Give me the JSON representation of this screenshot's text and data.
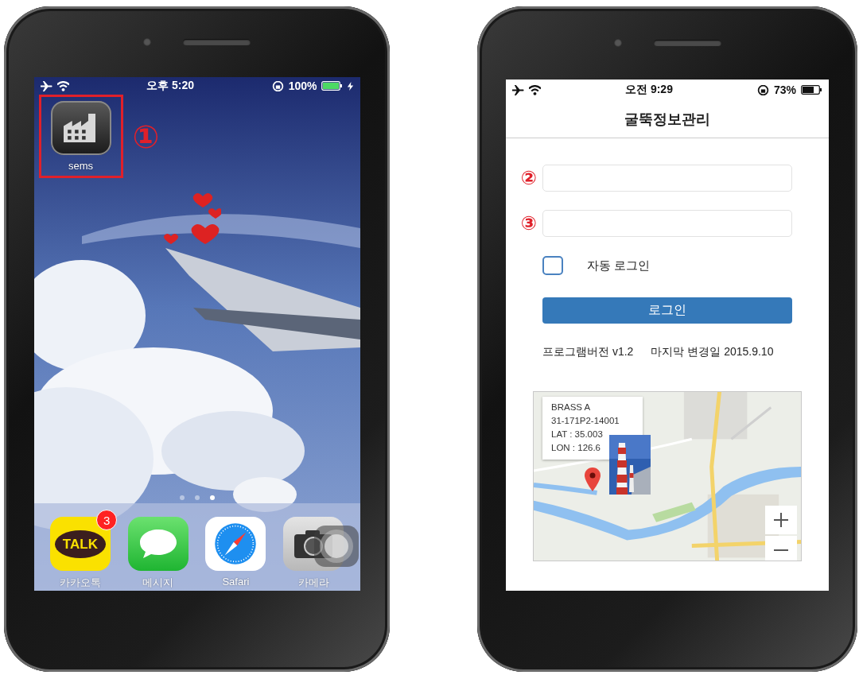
{
  "phones": [
    {
      "kind": "home_screen",
      "status_bar": {
        "time": "오후 5:20",
        "battery": "100%",
        "charging": true
      },
      "apps": [
        {
          "label": "sems",
          "kind": "factory",
          "highlighted": true,
          "callout": "①"
        }
      ],
      "page_dots": [
        {
          "selected": false
        },
        {
          "selected": false
        },
        {
          "selected": true
        }
      ],
      "dock": [
        {
          "label": "카카오톡",
          "kind": "talk",
          "icon_text": "TALK",
          "badge": "3"
        },
        {
          "label": "메시지",
          "kind": "messages"
        },
        {
          "label": "Safari",
          "kind": "safari"
        },
        {
          "label": "카메라",
          "kind": "camera"
        }
      ]
    },
    {
      "kind": "login_screen",
      "status_bar": {
        "time": "오전 9:29",
        "battery": "73%",
        "charging": false
      },
      "title": "굴뚝정보관리",
      "fields": [
        {
          "callout": "②"
        },
        {
          "callout": "③"
        }
      ],
      "auto_login": {
        "label": "자동 로그인",
        "checked": false
      },
      "login_button": "로그인",
      "version": "프로그램버전 v1.2",
      "last_modified": "마지막 변경일 2015.9.10",
      "map": {
        "popup": [
          "BRASS A",
          "31-171P2-14001",
          "LAT : 35.003",
          "LON : 126.6"
        ]
      }
    }
  ]
}
